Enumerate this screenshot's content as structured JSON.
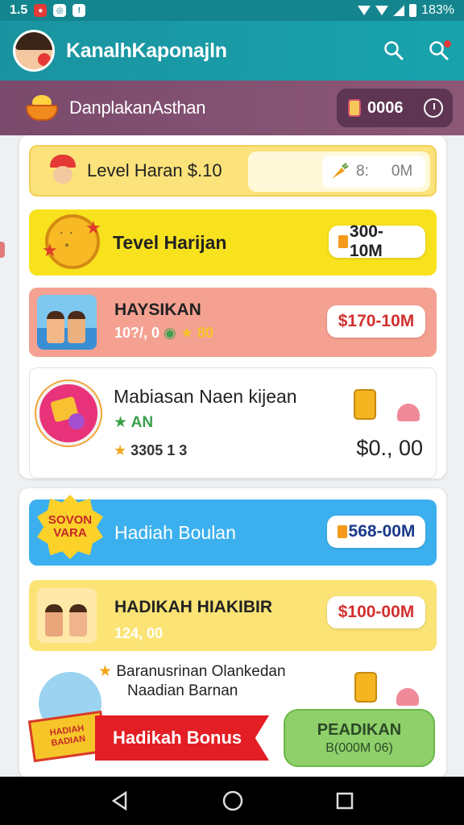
{
  "status_bar": {
    "time": "1.5",
    "battery": "183%"
  },
  "app_bar": {
    "title": "KanalhKaponajln"
  },
  "strip": {
    "title": "DanplakanAsthan",
    "coins": "0006"
  },
  "cards": [
    {
      "title": "Level Haran $.10",
      "field_value": "8:",
      "field_unit": "0M"
    },
    {
      "title": "Tevel Harijan",
      "price": "300-10M"
    },
    {
      "title": "HAYSIKAN",
      "sub": "10?/, 0",
      "sub_stars": "80",
      "price": "$170-10M"
    },
    {
      "title": "Mabiasan  Naen kijean",
      "sub": "AN",
      "stars": "3305  1  3",
      "price": "$0., 00"
    },
    {
      "title": "Hadiah Boulan",
      "badge": "SOVON VARA",
      "price": "568-00M"
    },
    {
      "title": "HADIKAH HIAKIBIR",
      "sub": "124, 00",
      "price": "$100-00M"
    }
  ],
  "bottom": {
    "line1": "Baranusrinan Olankedan",
    "line2": "Naadian Barnan",
    "ribbon": "Hadikah Bonus",
    "promo_badge": "HADIAH BADIAN",
    "cta_line1": "PEADIKAN",
    "cta_line2": "B(000M 06)"
  },
  "colors": {
    "teal": "#1a93a0",
    "purple": "#7a4a6c",
    "yellow": "#f8e21e",
    "red": "#e31e24",
    "blue": "#3cb0ee",
    "green": "#8fd06a"
  }
}
